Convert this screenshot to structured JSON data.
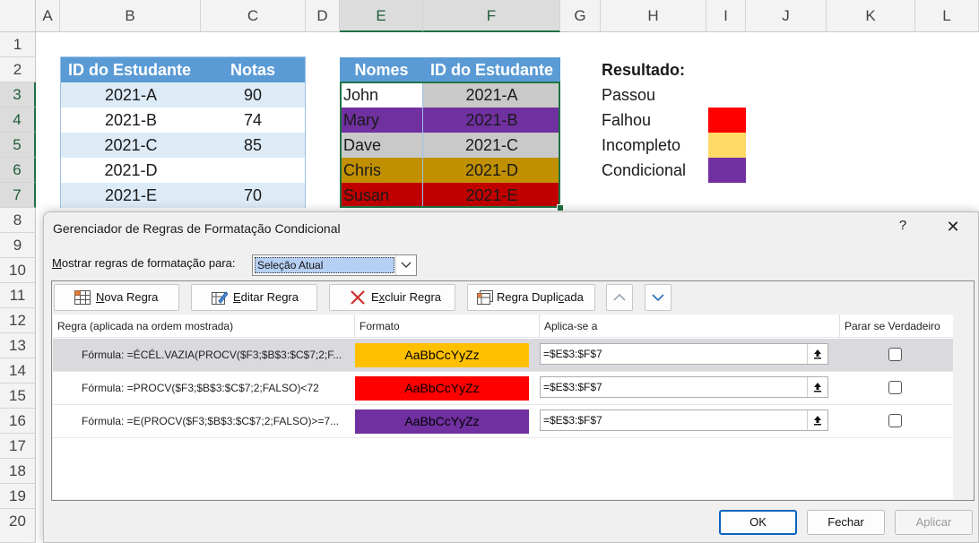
{
  "columns": [
    "A",
    "B",
    "C",
    "D",
    "E",
    "F",
    "G",
    "H",
    "I",
    "J",
    "K",
    "L"
  ],
  "rows": [
    "1",
    "2",
    "3",
    "4",
    "5",
    "6",
    "7",
    "8",
    "9",
    "10",
    "11",
    "12",
    "13",
    "14",
    "15",
    "16",
    "17",
    "18",
    "19",
    "20"
  ],
  "table1": {
    "headers": [
      "ID do Estudante",
      "Notas"
    ],
    "rows": [
      [
        "2021-A",
        "90"
      ],
      [
        "2021-B",
        "74"
      ],
      [
        "2021-C",
        "85"
      ],
      [
        "2021-D",
        ""
      ],
      [
        "2021-E",
        "70"
      ]
    ]
  },
  "table2": {
    "headers": [
      "Nomes",
      "ID do Estudante"
    ],
    "rows": [
      {
        "name": "John",
        "id": "2021-A",
        "fill": "#c9c9c9",
        "name_fill": "#ffffff"
      },
      {
        "name": "Mary",
        "id": "2021-B",
        "fill": "#7030a0",
        "name_fill": "#7030a0"
      },
      {
        "name": "Dave",
        "id": "2021-C",
        "fill": "#c9c9c9",
        "name_fill": "#c9c9c9"
      },
      {
        "name": "Chris",
        "id": "2021-D",
        "fill": "#c09000",
        "name_fill": "#c09000"
      },
      {
        "name": "Susan",
        "id": "2021-E",
        "fill": "#c00000",
        "name_fill": "#c00000"
      }
    ]
  },
  "legend": {
    "title": "Resultado:",
    "items": [
      {
        "label": "Passou",
        "color": ""
      },
      {
        "label": "Falhou",
        "color": "#ff0000"
      },
      {
        "label": "Incompleto",
        "color": "#ffd966"
      },
      {
        "label": "Condicional",
        "color": "#7030a0"
      }
    ]
  },
  "dialog": {
    "title": "Gerenciador de Regras de Formatação Condicional",
    "help": "?",
    "close": "✕",
    "show_rules_prefix": "M",
    "show_rules_label": "ostrar regras de formatação para:",
    "show_rules_value": "Seleção Atual",
    "toolbar": {
      "new_rule_u": "N",
      "new_rule": "ova Regra",
      "edit_rule_u": "E",
      "edit_rule": "ditar Regra",
      "delete_rule_u": "x",
      "delete_rule_pre": "E",
      "delete_rule": "cluir Regra",
      "dup_rule_pre": "Regra Dupli",
      "dup_rule_u": "c",
      "dup_rule": "ada"
    },
    "grid_headers": {
      "rule": "Regra (aplicada na ordem mostrada)",
      "format": "Formato",
      "applies": "Aplica-se a",
      "stop": "Parar se Verdadeiro"
    },
    "rules": [
      {
        "formula": "Fórmula: =ÉCÉL.VAZIA(PROCV($F3;$B$3:$C$7;2;F...",
        "preview": "AaBbCcYyZz",
        "fill": "#ffc000",
        "applies": "=$E$3:$F$7"
      },
      {
        "formula": "Fórmula: =PROCV($F3;$B$3:$C$7;2;FALSO)<72",
        "preview": "AaBbCcYyZz",
        "fill": "#ff0000",
        "applies": "=$E$3:$F$7"
      },
      {
        "formula": "Fórmula: =E(PROCV($F3;$B$3:$C$7;2;FALSO)>=7...",
        "preview": "AaBbCcYyZz",
        "fill": "#7030a0",
        "applies": "=$E$3:$F$7"
      }
    ],
    "buttons": {
      "ok": "OK",
      "close": "Fechar",
      "apply": "Aplicar"
    }
  }
}
